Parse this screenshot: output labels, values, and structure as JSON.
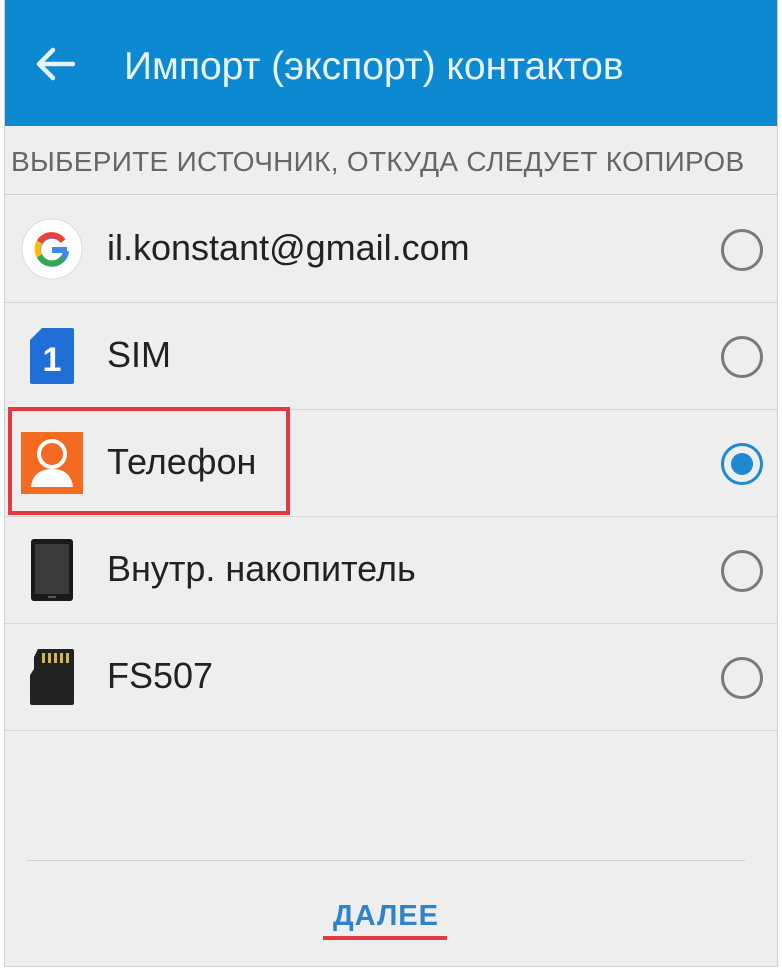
{
  "appbar": {
    "back_icon": "arrow-left-icon",
    "title": "Импорт (экспорт) контактов",
    "color": "#0d89d2"
  },
  "subheader": "ВЫБЕРИТЕ ИСТОЧНИК, ОТКУДА СЛЕДУЕТ КОПИРОВ",
  "sources": [
    {
      "label": "il.konstant@gmail.com",
      "icon": "google-icon",
      "selected": false
    },
    {
      "label": "SIM",
      "icon": "sim-card-icon",
      "selected": false
    },
    {
      "label": "Телефон",
      "icon": "person-icon",
      "selected": true
    },
    {
      "label": "Внутр. накопитель",
      "icon": "tablet-icon",
      "selected": false
    },
    {
      "label": "FS507",
      "icon": "sd-card-icon",
      "selected": false
    }
  ],
  "sim_badge": "1",
  "next_button": "ДАЛЕЕ",
  "accent_color": "#1e88d2",
  "highlight_color": "#e53940"
}
